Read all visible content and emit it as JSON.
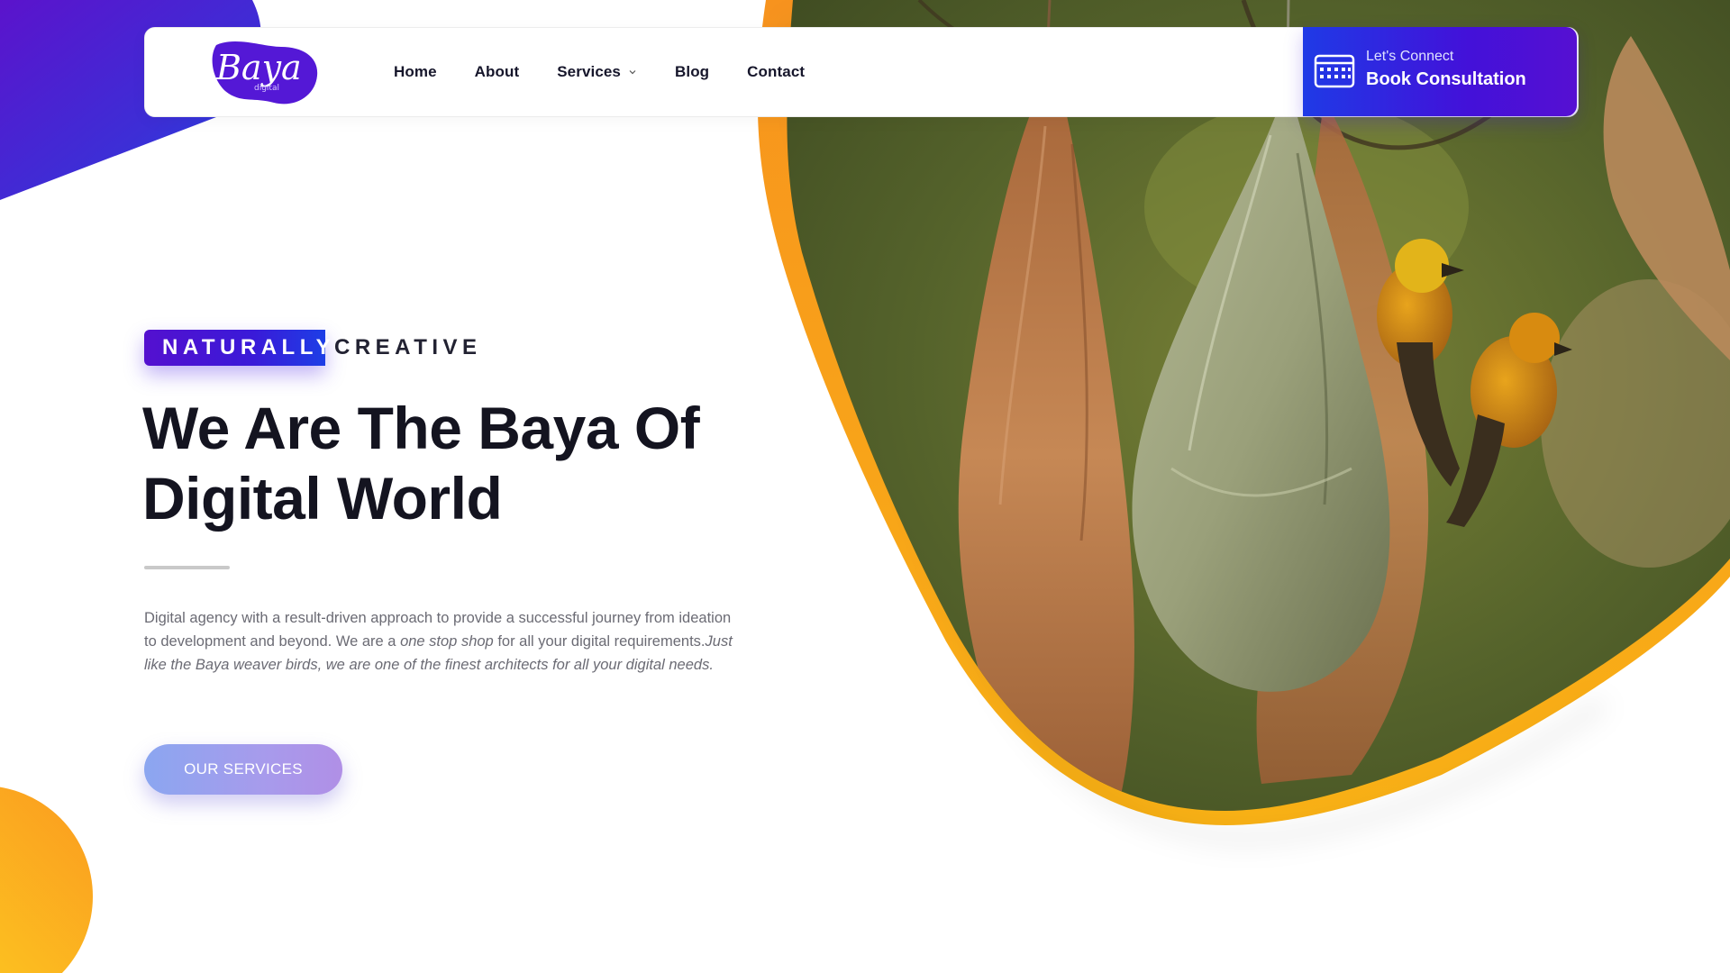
{
  "brand": {
    "logo_text": "Baya",
    "logo_subtext": "digital"
  },
  "nav": {
    "items": [
      {
        "label": "Home"
      },
      {
        "label": "About"
      },
      {
        "label": "Services",
        "has_dropdown": true
      },
      {
        "label": "Blog"
      },
      {
        "label": "Contact"
      }
    ]
  },
  "cta": {
    "small_label": "Let's Connect",
    "big_label": "Book Consultation",
    "icon": "calendar-icon"
  },
  "hero": {
    "tag_highlight": "NATURALLY",
    "tag_rest": "CREATIVE",
    "headline_line1": "We Are The Baya Of",
    "headline_line2": "Digital World",
    "desc_part1": "Digital agency with a result-driven approach to provide a successful journey from ideation to development and beyond. We are a ",
    "desc_italic1": "one stop shop",
    "desc_part2": " for all your digital requirements.",
    "desc_italic2": "Just like the Baya weaver birds, we are one of the finest architects for all your digital needs.",
    "button_label": "OUR SERVICES"
  },
  "colors": {
    "brand_purple": "#4311d9",
    "brand_blue": "#1f3ae6",
    "accent_orange": "#f7931e",
    "accent_yellow": "#f9c31b",
    "text_dark": "#141420",
    "text_muted": "#6b6b74"
  }
}
